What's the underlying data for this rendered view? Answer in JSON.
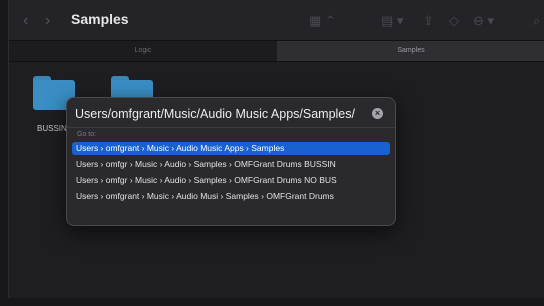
{
  "window": {
    "title": "Samples"
  },
  "tabs": [
    {
      "label": "Logic",
      "active": false
    },
    {
      "label": "Samples",
      "active": true
    }
  ],
  "folders": [
    {
      "label": "BUSSIN"
    },
    {
      "label": ""
    }
  ],
  "goto": {
    "path_value": "Users/omfgrant/Music/Audio Music Apps/Samples/",
    "label": "Go to:",
    "suggestions": [
      "Users › omfgrant › Music › Audio Music Apps › Samples",
      "Users › omfgr › Music › Audio › Samples › OMFGrant Drums BUSSIN",
      "Users › omfgr › Music › Audio › Samples › OMFGrant Drums NO BUS",
      "Users › omfgrant › Music › Audio Musi › Samples › OMFGrant Drums"
    ],
    "selected_index": 0
  },
  "colors": {
    "accent": "#1960d0",
    "folder": "#3a8ec4"
  }
}
